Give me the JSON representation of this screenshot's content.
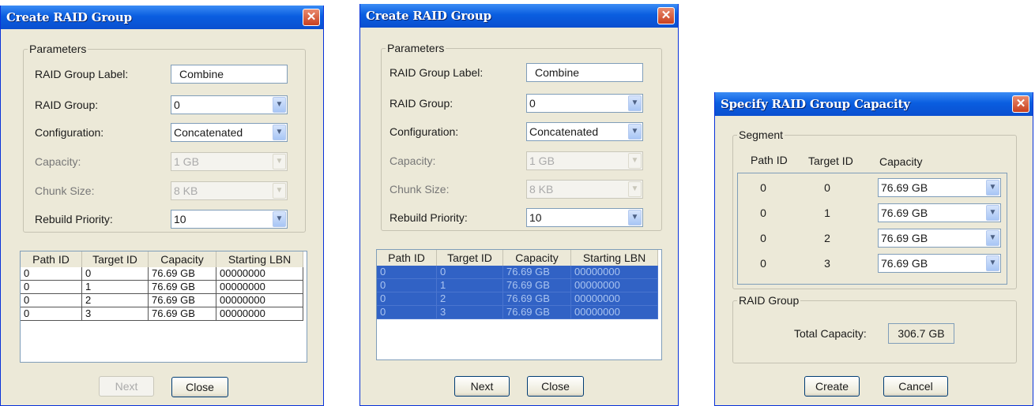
{
  "dialog1": {
    "title": "Create RAID Group",
    "close_glyph": "✕",
    "params_legend": "Parameters",
    "fields": {
      "label_label": "RAID Group Label:",
      "label_value": "Combine",
      "group_label": "RAID Group:",
      "group_value": "0",
      "config_label": "Configuration:",
      "config_value": "Concatenated",
      "capacity_label": "Capacity:",
      "capacity_value": "1 GB",
      "chunk_label": "Chunk Size:",
      "chunk_value": "8 KB",
      "rebuild_label": "Rebuild Priority:",
      "rebuild_value": "10"
    },
    "columns": [
      "Path ID",
      "Target ID",
      "Capacity",
      "Starting LBN"
    ],
    "rows": [
      [
        "0",
        "0",
        "76.69 GB",
        "00000000"
      ],
      [
        "0",
        "1",
        "76.69 GB",
        "00000000"
      ],
      [
        "0",
        "2",
        "76.69 GB",
        "00000000"
      ],
      [
        "0",
        "3",
        "76.69 GB",
        "00000000"
      ]
    ],
    "rows_selected": false,
    "next_label": "Next",
    "next_enabled": false,
    "close_label": "Close"
  },
  "dialog2": {
    "title": "Create RAID Group",
    "close_glyph": "✕",
    "params_legend": "Parameters",
    "fields": {
      "label_label": "RAID Group Label:",
      "label_value": "Combine",
      "group_label": "RAID Group:",
      "group_value": "0",
      "config_label": "Configuration:",
      "config_value": "Concatenated",
      "capacity_label": "Capacity:",
      "capacity_value": "1 GB",
      "chunk_label": "Chunk Size:",
      "chunk_value": "8 KB",
      "rebuild_label": "Rebuild Priority:",
      "rebuild_value": "10"
    },
    "columns": [
      "Path ID",
      "Target ID",
      "Capacity",
      "Starting LBN"
    ],
    "rows": [
      [
        "0",
        "0",
        "76.69 GB",
        "00000000"
      ],
      [
        "0",
        "1",
        "76.69 GB",
        "00000000"
      ],
      [
        "0",
        "2",
        "76.69 GB",
        "00000000"
      ],
      [
        "0",
        "3",
        "76.69 GB",
        "00000000"
      ]
    ],
    "rows_selected": true,
    "next_label": "Next",
    "next_enabled": true,
    "close_label": "Close"
  },
  "dialog3": {
    "title": "Specify RAID Group Capacity",
    "close_glyph": "✕",
    "segment_legend": "Segment",
    "col_path": "Path ID",
    "col_target": "Target ID",
    "col_capacity": "Capacity",
    "segments": [
      {
        "path": "0",
        "target": "0",
        "capacity": "76.69 GB"
      },
      {
        "path": "0",
        "target": "1",
        "capacity": "76.69 GB"
      },
      {
        "path": "0",
        "target": "2",
        "capacity": "76.69 GB"
      },
      {
        "path": "0",
        "target": "3",
        "capacity": "76.69 GB"
      }
    ],
    "group_legend": "RAID Group",
    "total_label": "Total Capacity:",
    "total_value": "306.7 GB",
    "create_label": "Create",
    "cancel_label": "Cancel"
  },
  "icons": {
    "dropdown": "chevron-down-icon",
    "close": "close-icon"
  },
  "colors": {
    "title_bar": "#0a5ee0",
    "close_button": "#c8401f",
    "dialog_bg": "#ece9d8",
    "selection": "#3162c5"
  }
}
